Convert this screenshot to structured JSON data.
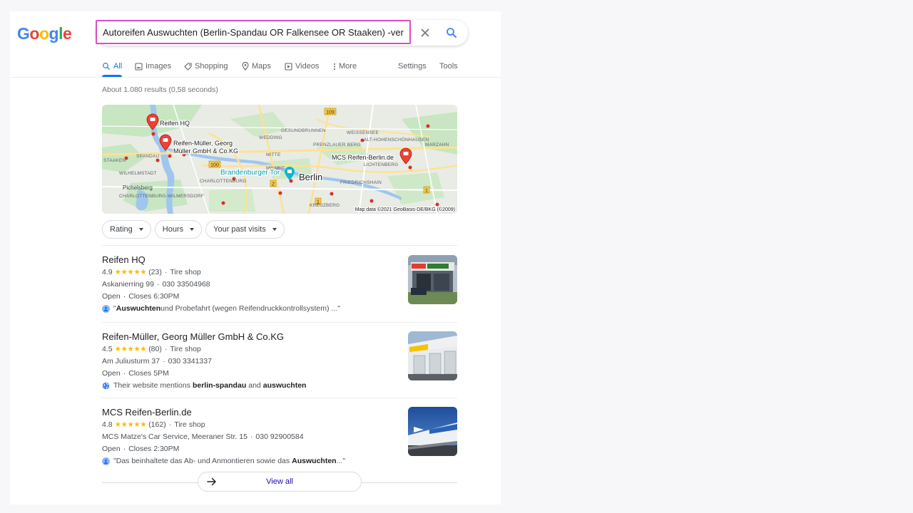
{
  "logo": {
    "letters": [
      "G",
      "o",
      "o",
      "g",
      "l",
      "e"
    ],
    "colors": [
      "#4285f4",
      "#ea4335",
      "#fbbc05",
      "#4285f4",
      "#34a853",
      "#ea4335"
    ]
  },
  "search": {
    "query": "Autoreifen Auswuchten (Berlin-Spandau OR Falkensee OR Staaken) -verkauf",
    "highlight_color": "#d94fc3"
  },
  "tabs": {
    "all": "All",
    "images": "Images",
    "shopping": "Shopping",
    "maps": "Maps",
    "videos": "Videos",
    "more": "More",
    "settings": "Settings",
    "tools": "Tools"
  },
  "result_stats": "About 1.080 results (0,58 seconds)",
  "map": {
    "attribution": "Map data ©2021 GeoBasis-DE/BKG (©2009)",
    "places": {
      "reifen_hq": "Reifen HQ",
      "reifen_mueller_1": "Reifen-Müller, Georg",
      "reifen_mueller_2": "Müller GmbH & Co.KG",
      "mcs": "MCS Reifen-Berlin.de",
      "brandenburger_tor": "Brandenburger Tor",
      "berlin": "Berlin"
    },
    "districts": {
      "gesundbrunnen": "GESUNDBRUNNEN",
      "weissensee": "WEISSENSEE",
      "wedding": "WEDDING",
      "alt_hohenschoenhausen": "ALT-HOHENSCHÖNHAUSEN",
      "prenzlauer_berg": "PRENZLAUER BERG",
      "marzahn": "MARZAHN",
      "spandau": "SPANDAU",
      "mitte": "MITTE",
      "lichtenberg": "LICHTENBERG",
      "staaken": "STAAKEN",
      "moabit": "MOABIT",
      "wilhelmstadt": "WILHELMSTADT",
      "charlottenburg": "CHARLOTTENBURG",
      "pichelsberg": "Pichelsberg",
      "friedrichshain": "FRIEDRICHSHAIN",
      "charlottenburg_wilmersdorf": "CHARLOTTENBURG-WILMERSDORF",
      "kreuzberg": "KREUZBERG"
    },
    "road_shields": {
      "r109": "109",
      "r100": "100",
      "r2a": "2",
      "r2b": "2",
      "r1a": "1",
      "r1b": "1"
    }
  },
  "filters": {
    "rating": "Rating",
    "hours": "Hours",
    "past_visits": "Your past visits"
  },
  "listings": [
    {
      "name": "Reifen HQ",
      "rating": "4.9",
      "stars": "★★★★★",
      "reviews": "(23)",
      "category": "Tire shop",
      "address": "Askanierring 99",
      "phone": "030 33504968",
      "open": "Open",
      "closes": "Closes 6:30PM",
      "snippet_bold": "Auswuchten",
      "snippet_rest": " und Probefahrt (wegen Reifendruckkontrollsystem) ...\"",
      "snippet_open_quote": "\""
    },
    {
      "name": "Reifen-Müller, Georg Müller GmbH & Co.KG",
      "rating": "4.5",
      "stars": "★★★★★",
      "reviews": "(80)",
      "category": "Tire shop",
      "address": "Am Juliusturm 37",
      "phone": "030 3341337",
      "open": "Open",
      "closes": "Closes 5PM",
      "snippet_prefix": "Their website mentions ",
      "snippet_bold_1": "berlin-spandau",
      "snippet_mid": " and ",
      "snippet_bold_2": "auswuchten"
    },
    {
      "name": "MCS Reifen-Berlin.de",
      "rating": "4.8",
      "stars": "★★★★★",
      "reviews": "(162)",
      "category": "Tire shop",
      "address": "MCS Matze's Car Service, Meeraner Str. 15",
      "phone": "030 92900584",
      "open": "Open",
      "closes": "Closes 2:30PM",
      "snippet_open_quote": "\"",
      "snippet_pre": "Das beinhaltete das Ab- und Anmontieren sowie das ",
      "snippet_bold": "Auswuchten",
      "snippet_rest": " ...\""
    }
  ],
  "sep": "·",
  "view_all": "View all",
  "colors": {
    "accent": "#1a73e8",
    "stars": "#fbbc04",
    "link": "#1a0dab"
  }
}
